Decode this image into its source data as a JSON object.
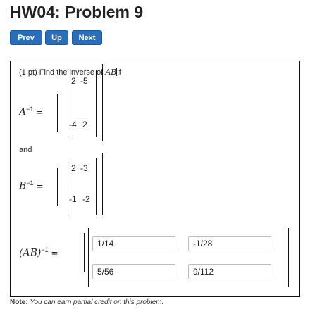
{
  "page": {
    "title": "HW04: Problem 9"
  },
  "nav": {
    "prev_label": "Prev",
    "up_label": "Up",
    "next_label": "Next"
  },
  "problem": {
    "points": "(1 pt)",
    "prompt_text": "Find the inverse of",
    "prompt_math": "AB",
    "prompt_suffix": "if",
    "matrix_a": {
      "label": "A",
      "exponent": "−1",
      "equals": "=",
      "rows": [
        [
          "2",
          "-5"
        ],
        [
          "-4",
          "2"
        ]
      ]
    },
    "and_text": "and",
    "matrix_b": {
      "label": "B",
      "exponent": "−1",
      "equals": "=",
      "rows": [
        [
          "2",
          "-3"
        ],
        [
          "-1",
          "-2"
        ]
      ]
    },
    "answer": {
      "label": "(AB)",
      "exponent": "−1",
      "equals": "=",
      "fields": [
        [
          "1/14",
          "-1/28"
        ],
        [
          "5/56",
          "9/112"
        ]
      ]
    }
  },
  "footer": {
    "note_label": "Note:",
    "note_text": "You can earn partial credit on this problem."
  }
}
